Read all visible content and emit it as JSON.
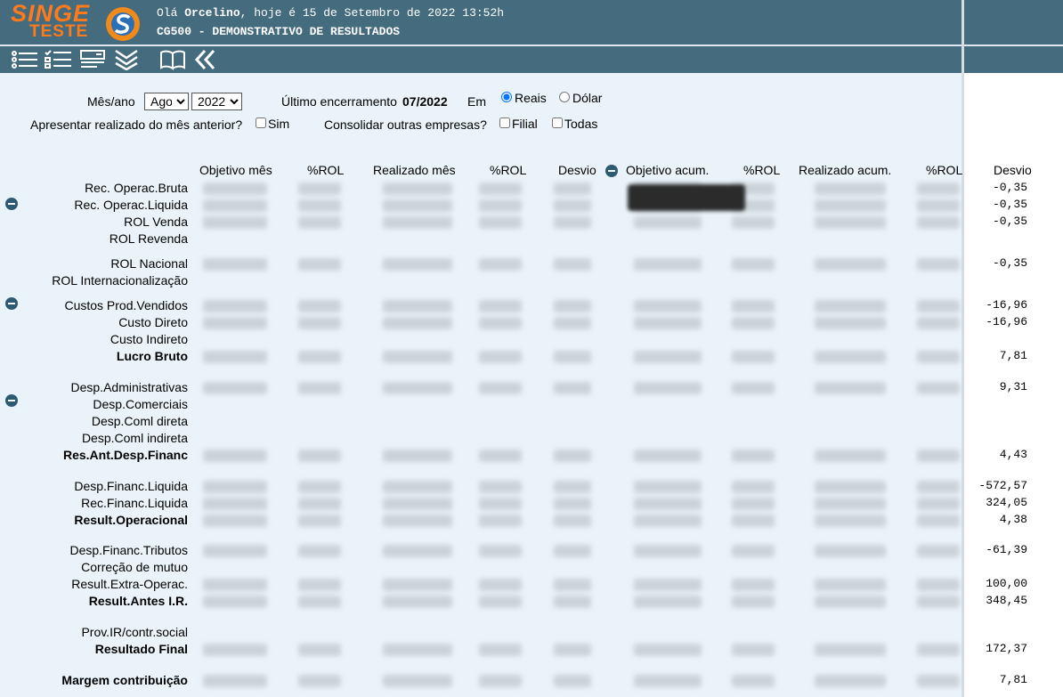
{
  "header": {
    "logo_top": "SINGE",
    "logo_bottom": "TESTE",
    "greeting_prefix": "Olá ",
    "user": "Orcelino",
    "greeting_suffix": ", hoje é 15 de Setembro de 2022 13:52h",
    "screen_title": "CG500 - DEMONSTRATIVO DE RESULTADOS"
  },
  "toolbar": {
    "icons": [
      "list-icon",
      "checklist-icon",
      "form-icon",
      "expand-all-icon",
      "book-icon",
      "back-icon"
    ]
  },
  "filters": {
    "month_year_label": "Mês/ano",
    "month_value": "Ago",
    "year_value": "2022",
    "last_closing_label": "Último encerramento",
    "last_closing_value": "07/2022",
    "currency_label": "Em",
    "currency_reais": "Reais",
    "currency_dolar": "Dólar",
    "prev_month_question": "Apresentar realizado do mês anterior?",
    "prev_month_option": "Sim",
    "consolidate_question": "Consolidar outras empresas?",
    "consolidate_filial": "Filial",
    "consolidate_todas": "Todas"
  },
  "table": {
    "columns": [
      "Objetivo mês",
      "%ROL",
      "Realizado mês",
      "%ROL",
      "Desvio",
      "Objetivo acum.",
      "%ROL",
      "Realizado acum.",
      "%ROL",
      "Desvio"
    ],
    "rows": [
      {
        "label": "Rec. Operac.Bruta",
        "desvio": "-0,35"
      },
      {
        "label": "Rec. Operac.Liquida",
        "desvio": "-0,35"
      },
      {
        "label": "ROL Venda",
        "desvio": "-0,35"
      },
      {
        "label": "ROL Revenda",
        "desvio": ""
      },
      {
        "label": "ROL Nacional",
        "desvio": "-0,35"
      },
      {
        "label": "ROL Internacionalização",
        "desvio": ""
      },
      {
        "label": "Custos Prod.Vendidos",
        "desvio": "-16,96"
      },
      {
        "label": "Custo Direto",
        "desvio": "-16,96"
      },
      {
        "label": "Custo Indireto",
        "desvio": ""
      },
      {
        "label": "Lucro Bruto",
        "desvio": "7,81"
      },
      {
        "label": "Desp.Administrativas",
        "desvio": "9,31"
      },
      {
        "label": "Desp.Comerciais",
        "desvio": ""
      },
      {
        "label": "Desp.Coml direta",
        "desvio": ""
      },
      {
        "label": "Desp.Coml indireta",
        "desvio": ""
      },
      {
        "label": "Res.Ant.Desp.Financ",
        "desvio": "4,43"
      },
      {
        "label": "Desp.Financ.Liquida",
        "desvio": "-572,57"
      },
      {
        "label": "Rec.Financ.Liquida",
        "desvio": "324,05"
      },
      {
        "label": "Result.Operacional",
        "desvio": "4,38"
      },
      {
        "label": "Desp.Financ.Tributos",
        "desvio": "-61,39"
      },
      {
        "label": "Correção de mutuo",
        "desvio": ""
      },
      {
        "label": "Result.Extra-Operac.",
        "desvio": "100,00"
      },
      {
        "label": "Result.Antes I.R.",
        "desvio": "348,45"
      },
      {
        "label": "Prov.IR/contr.social",
        "desvio": ""
      },
      {
        "label": "Resultado Final",
        "desvio": "172,37"
      },
      {
        "label": "Margem contribuição",
        "desvio": "7,81"
      }
    ]
  },
  "colors": {
    "header_bg": "#456b7f",
    "content_bg": "#eaf3f9",
    "logo": "#ff7a1a"
  }
}
